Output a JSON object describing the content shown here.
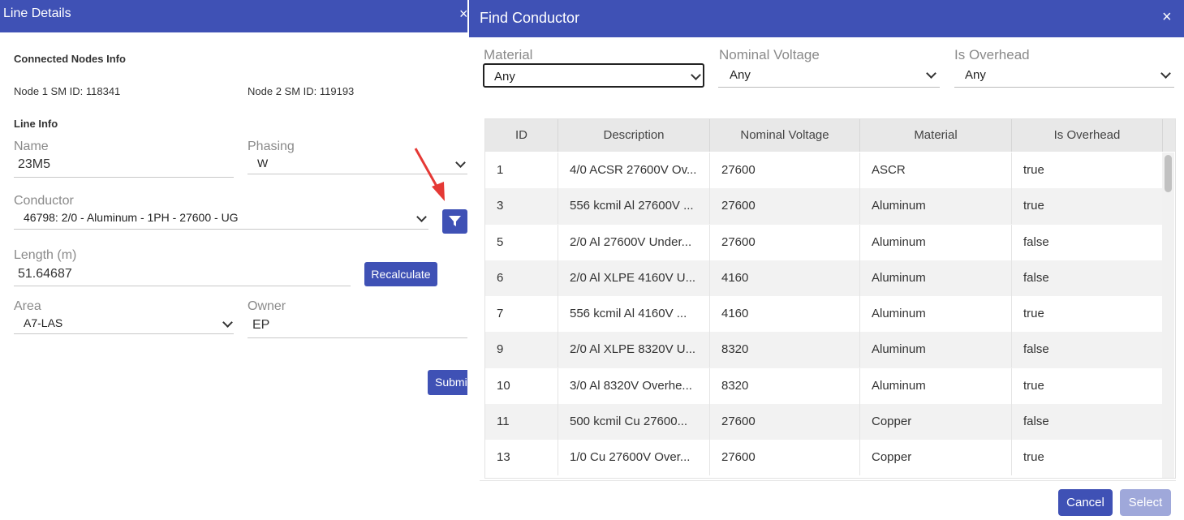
{
  "line_details": {
    "title": "Line Details",
    "close": "×",
    "connected_nodes_title": "Connected Nodes Info",
    "node1": "Node 1 SM ID: 118341",
    "node2": "Node 2 SM ID: 119193",
    "line_info_title": "Line Info",
    "name_label": "Name",
    "name_value": "23M5",
    "phasing_label": "Phasing",
    "phasing_value": "W",
    "conductor_label": "Conductor",
    "conductor_value": "46798: 2/0 - Aluminum - 1PH - 27600 - UG",
    "length_label": "Length (m)",
    "length_value": "51.64687",
    "recalculate_label": "Recalculate",
    "area_label": "Area",
    "area_value": "A7-LAS",
    "owner_label": "Owner",
    "owner_value": "EP",
    "submit_label": "Submi",
    "filter_icon": "filter-icon",
    "annotation_arrow_color": "#e53935"
  },
  "find_conductor": {
    "title": "Find Conductor",
    "close": "×",
    "filters": {
      "material_label": "Material",
      "material_value": "Any",
      "voltage_label": "Nominal Voltage",
      "voltage_value": "Any",
      "overhead_label": "Is Overhead",
      "overhead_value": "Any"
    },
    "columns": [
      "ID",
      "Description",
      "Nominal Voltage",
      "Material",
      "Is Overhead"
    ],
    "rows": [
      [
        "1",
        "4/0 ACSR 27600V Ov...",
        "27600",
        "ASCR",
        "true"
      ],
      [
        "3",
        "556 kcmil Al 27600V ...",
        "27600",
        "Aluminum",
        "true"
      ],
      [
        "5",
        "2/0 Al 27600V Under...",
        "27600",
        "Aluminum",
        "false"
      ],
      [
        "6",
        "2/0 Al XLPE 4160V U...",
        "4160",
        "Aluminum",
        "false"
      ],
      [
        "7",
        "556 kcmil Al 4160V ...",
        "4160",
        "Aluminum",
        "true"
      ],
      [
        "9",
        "2/0 Al XLPE 8320V U...",
        "8320",
        "Aluminum",
        "false"
      ],
      [
        "10",
        "3/0 Al 8320V Overhe...",
        "8320",
        "Aluminum",
        "true"
      ],
      [
        "11",
        "500 kcmil Cu 27600...",
        "27600",
        "Copper",
        "false"
      ],
      [
        "13",
        "1/0 Cu 27600V Over...",
        "27600",
        "Copper",
        "true"
      ]
    ],
    "cancel_label": "Cancel",
    "select_label": "Select"
  },
  "colors": {
    "primary": "#3f51b5",
    "disabled": "#9fa8da"
  }
}
